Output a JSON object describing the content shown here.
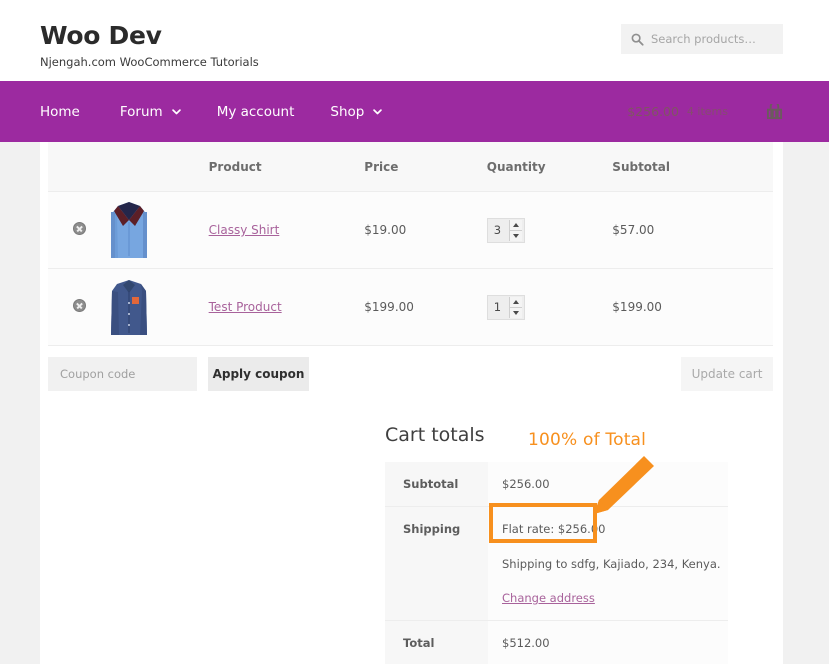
{
  "header": {
    "brand_title": "Woo Dev",
    "brand_tagline": "Njengah.com WooCommerce Tutorials",
    "search_placeholder": "Search products…",
    "search_value": "",
    "search_icon": "search-icon"
  },
  "nav": {
    "items": [
      {
        "label": "Home",
        "has_caret": false
      },
      {
        "label": "Forum",
        "has_caret": true
      },
      {
        "label": "My account",
        "has_caret": false
      },
      {
        "label": "Shop",
        "has_caret": true
      }
    ],
    "cart_amount": "$256.00",
    "cart_count": "4 items",
    "cart_icon": "shopping-basket-icon",
    "background": "#9c2aa0"
  },
  "cart_table": {
    "headers": [
      "",
      "",
      "Product",
      "Price",
      "Quantity",
      "Subtotal"
    ],
    "rows": [
      {
        "remove_icon": "remove-item-icon",
        "thumb": "classy-shirt-thumbnail",
        "name": "Classy Shirt",
        "price": "$19.00",
        "quantity": "3",
        "subtotal": "$57.00"
      },
      {
        "remove_icon": "remove-item-icon",
        "thumb": "test-product-thumbnail",
        "name": "Test Product",
        "price": "$199.00",
        "quantity": "1",
        "subtotal": "$199.00"
      }
    ]
  },
  "coupon": {
    "placeholder": "Coupon code",
    "value": "",
    "apply_label": "Apply coupon",
    "update_label": "Update cart"
  },
  "totals": {
    "title": "Cart totals",
    "subtotal_label": "Subtotal",
    "subtotal_value": "$256.00",
    "shipping_label": "Shipping",
    "shipping_method": "Flat rate: $256.00",
    "shipping_to": "Shipping to sdfg, Kajiado, 234, Kenya.",
    "change_address_label": "Change address",
    "total_label": "Total",
    "total_value": "$512.00"
  },
  "annotation": {
    "label": "100% of Total",
    "color": "#f7901e",
    "highlight_target": "Flat rate: $256.00"
  }
}
